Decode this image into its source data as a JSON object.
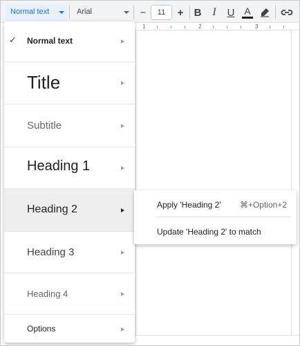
{
  "toolbar": {
    "style_value": "Normal text",
    "font_value": "Arial",
    "size_value": "11",
    "decrease_label": "−",
    "increase_label": "+",
    "bold_label": "B",
    "italic_label": "I",
    "underline_label": "U",
    "text_color_label": "A",
    "highlight_icon": "marker-icon",
    "link_icon": "link-icon",
    "text_color_hex": "#202124",
    "accent_hex": "#1a73e8"
  },
  "ruler": {
    "marks": [
      "1",
      "2",
      "3"
    ]
  },
  "style_menu": {
    "items": [
      {
        "label": "Normal text",
        "checked": true
      },
      {
        "label": "Title"
      },
      {
        "label": "Subtitle"
      },
      {
        "label": "Heading 1"
      },
      {
        "label": "Heading 2",
        "highlighted": true
      },
      {
        "label": "Heading 3"
      },
      {
        "label": "Heading 4"
      },
      {
        "label": "Options"
      }
    ],
    "check_mark": "✓"
  },
  "submenu": {
    "apply_label": "Apply 'Heading 2'",
    "apply_shortcut": "⌘+Option+2",
    "update_label": "Update 'Heading 2' to match"
  }
}
